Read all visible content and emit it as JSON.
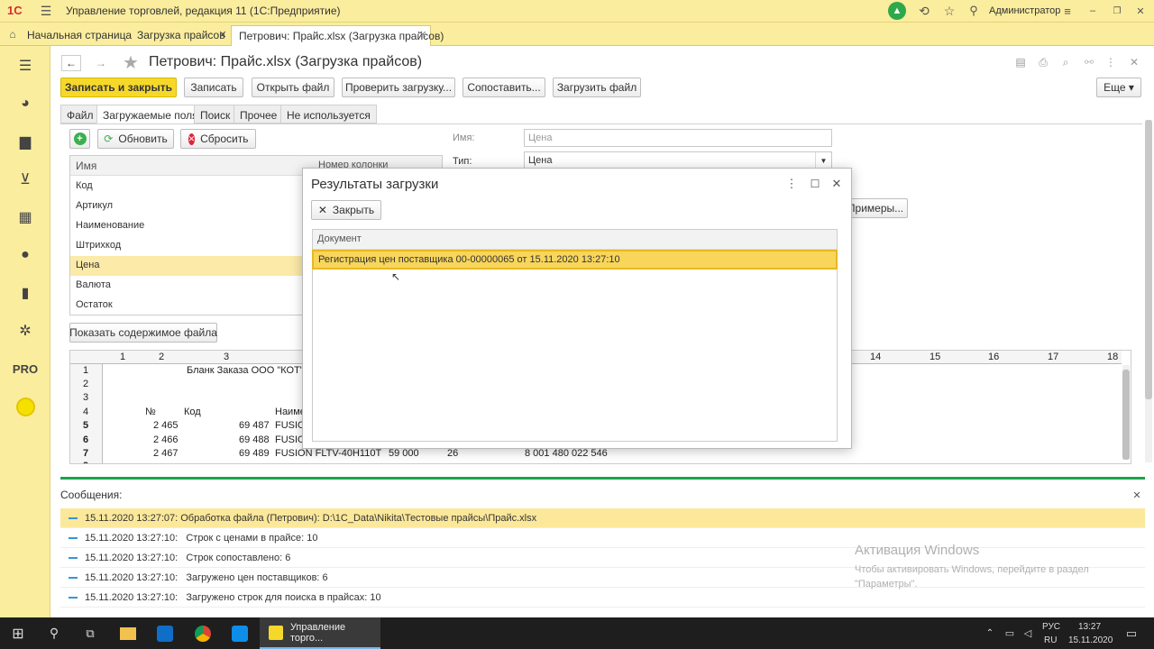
{
  "titlebar": {
    "logo": "1С",
    "title": "Управление торговлей, редакция 11 (1С:Предприятие)",
    "user": "Администратор"
  },
  "tabs": [
    {
      "label": "Начальная страница"
    },
    {
      "label": "Загрузка прайсов"
    },
    {
      "label": "Петрович: Прайс.xlsx (Загрузка прайсов)"
    }
  ],
  "sidebar": {
    "pro": "PRO"
  },
  "form": {
    "title": "Петрович: Прайс.xlsx (Загрузка прайсов)",
    "buttons": {
      "save_close": "Записать и закрыть",
      "save": "Записать",
      "open_file": "Открыть файл",
      "check": "Проверить загрузку...",
      "match": "Сопоставить...",
      "load": "Загрузить файл",
      "more": "Еще"
    },
    "subtabs": [
      "Файл",
      "Загружаемые поля",
      "Поиск",
      "Прочее",
      "Не используется"
    ],
    "refresh": "Обновить",
    "reset": "Сбросить",
    "columns": {
      "name": "Имя",
      "col_num": "Номер колонки"
    },
    "fields": [
      "Код",
      "Артикул",
      "Наименование",
      "Штрихкод",
      "Цена",
      "Валюта",
      "Остаток"
    ],
    "name_label": "Имя:",
    "name_value": "Цена",
    "type_label": "Тип:",
    "type_value": "Цена",
    "examples": "Примеры...",
    "show_file": "Показать содержимое файла"
  },
  "sheet": {
    "col_headers": [
      "1",
      "2",
      "3",
      "14",
      "15",
      "16",
      "17",
      "18"
    ],
    "row_nums": [
      "1",
      "2",
      "3",
      "4",
      "5",
      "6",
      "7",
      "8"
    ],
    "title": "Бланк Заказа ООО \"КОТ\"",
    "hdr_no": "№",
    "hdr_code": "Код",
    "hdr_name": "Наиме",
    "rows": [
      {
        "no": "2 465",
        "code": "69 487",
        "name": "FUSIO"
      },
      {
        "no": "2 466",
        "code": "69 488",
        "name": "FUSIO"
      },
      {
        "no": "2 467",
        "code": "69 489",
        "name": "FUSION FLTV-40H110T",
        "price": "59 000",
        "qty": "26",
        "barcode": "8 001 480 022 546"
      }
    ]
  },
  "modal": {
    "title": "Результаты загрузки",
    "close": "Закрыть",
    "col_doc": "Документ",
    "row": "Регистрация цен поставщика 00-00000065 от 15.11.2020 13:27:10"
  },
  "messages": {
    "title": "Сообщения:",
    "items": [
      {
        "text": "15.11.2020 13:27:07: Обработка файла (Петрович): D:\\1C_Data\\Nikita\\Тестовые прайсы\\Прайс.xlsx"
      },
      {
        "text": "15.11.2020 13:27:10:   Строк с ценами в прайсе: 10"
      },
      {
        "text": "15.11.2020 13:27:10:   Строк сопоставлено: 6"
      },
      {
        "text": "15.11.2020 13:27:10:   Загружено цен поставщиков: 6"
      },
      {
        "text": "15.11.2020 13:27:10:   Загружено строк для поиска в прайсах: 10"
      }
    ]
  },
  "watermark": {
    "title": "Активация Windows",
    "text": "Чтобы активировать Windows, перейдите в раздел \"Параметры\"."
  },
  "taskbar": {
    "app": "Управление торго...",
    "lang1": "РУС",
    "lang2": "RU",
    "time": "13:27",
    "date": "15.11.2020"
  }
}
